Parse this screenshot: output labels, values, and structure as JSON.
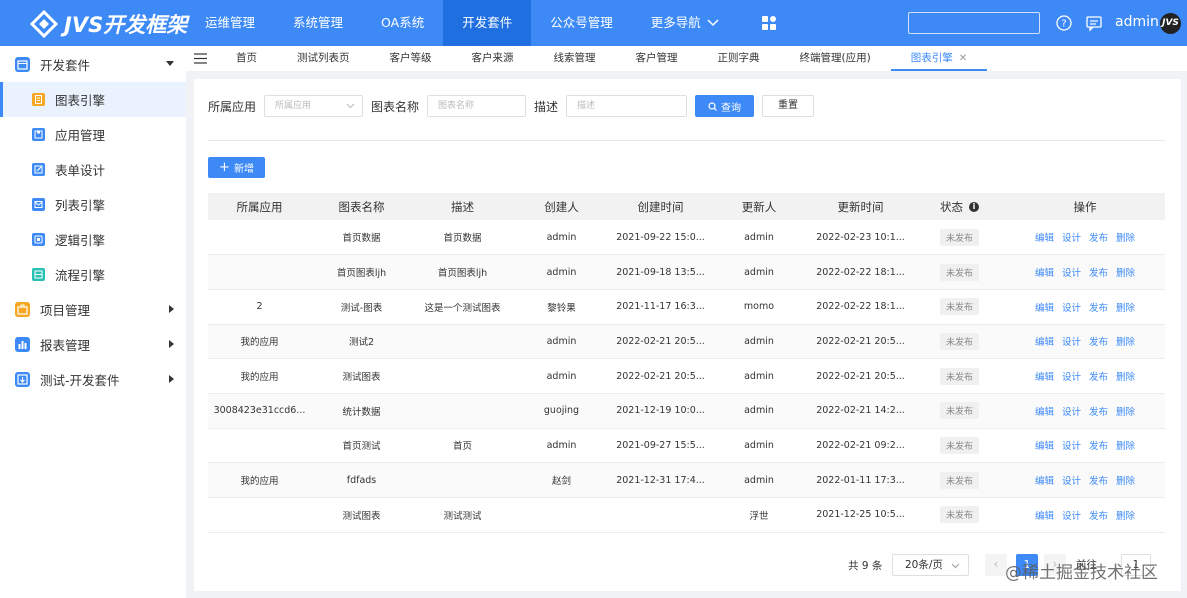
{
  "app": {
    "logo_text": "JVS开发框架",
    "top_nav": [
      {
        "label": "运维管理",
        "active": false
      },
      {
        "label": "系统管理",
        "active": false
      },
      {
        "label": "OA系统",
        "active": false
      },
      {
        "label": "开发套件",
        "active": true
      },
      {
        "label": "公众号管理",
        "active": false
      },
      {
        "label": "更多导航",
        "active": false
      }
    ],
    "admin_name": "admin",
    "avatar_text": "JVS",
    "accent_color": "#3d8af7"
  },
  "sidebar": {
    "group_dev": {
      "label": "开发套件",
      "icon": "calendar-icon",
      "expanded": true
    },
    "items": [
      {
        "label": "图表引擎",
        "icon": "document-icon",
        "active": true
      },
      {
        "label": "应用管理",
        "icon": "save-icon",
        "active": false
      },
      {
        "label": "表单设计",
        "icon": "edit-icon",
        "active": false
      },
      {
        "label": "列表引擎",
        "icon": "mail-icon",
        "active": false
      },
      {
        "label": "逻辑引擎",
        "icon": "box-icon",
        "active": false
      },
      {
        "label": "流程引擎",
        "icon": "flow-icon",
        "active": false
      }
    ],
    "groups": [
      {
        "label": "项目管理",
        "icon": "briefcase-icon"
      },
      {
        "label": "报表管理",
        "icon": "bar-chart-icon"
      },
      {
        "label": "测试-开发套件",
        "icon": "download-icon"
      }
    ]
  },
  "tabs": [
    {
      "label": "首页",
      "active": false
    },
    {
      "label": "测试列表页",
      "active": false
    },
    {
      "label": "客户等级",
      "active": false
    },
    {
      "label": "客户来源",
      "active": false
    },
    {
      "label": "线索管理",
      "active": false
    },
    {
      "label": "客户管理",
      "active": false
    },
    {
      "label": "正则字典",
      "active": false
    },
    {
      "label": "终端管理(应用)",
      "active": false
    },
    {
      "label": "图表引擎",
      "active": true
    }
  ],
  "filter": {
    "app_label": "所属应用",
    "app_placeholder": "所属应用",
    "name_label": "图表名称",
    "name_placeholder": "图表名称",
    "desc_label": "描述",
    "desc_placeholder": "描述",
    "search_button": "查询",
    "reset_button": "重置"
  },
  "add_button": "新增",
  "table": {
    "headers": [
      "所属应用",
      "图表名称",
      "描述",
      "创建人",
      "创建时间",
      "更新人",
      "更新时间",
      "状态",
      "操作"
    ],
    "rows": [
      {
        "app": "",
        "name": "首页数据",
        "desc": "首页数据",
        "creator": "admin",
        "created": "2021-09-22 15:0...",
        "updater": "admin",
        "updated": "2022-02-23 10:1...",
        "status": "未发布"
      },
      {
        "app": "",
        "name": "首页图表ljh",
        "desc": "首页图表ljh",
        "creator": "admin",
        "created": "2021-09-18 13:5...",
        "updater": "admin",
        "updated": "2022-02-22 18:1...",
        "status": "未发布"
      },
      {
        "app": "2",
        "name": "测试-图表",
        "desc": "这是一个测试图表",
        "creator": "黎铃果",
        "created": "2021-11-17 16:3...",
        "updater": "momo",
        "updated": "2022-02-22 18:1...",
        "status": "未发布"
      },
      {
        "app": "我的应用",
        "name": "测试2",
        "desc": "",
        "creator": "admin",
        "created": "2022-02-21 20:5...",
        "updater": "admin",
        "updated": "2022-02-21 20:5...",
        "status": "未发布"
      },
      {
        "app": "我的应用",
        "name": "测试图表",
        "desc": "",
        "creator": "admin",
        "created": "2022-02-21 20:5...",
        "updater": "admin",
        "updated": "2022-02-21 20:5...",
        "status": "未发布"
      },
      {
        "app": "3008423e31ccd6...",
        "name": "统计数据",
        "desc": "",
        "creator": "guojing",
        "created": "2021-12-19 10:0...",
        "updater": "admin",
        "updated": "2022-02-21 14:2...",
        "status": "未发布"
      },
      {
        "app": "",
        "name": "首页测试",
        "desc": "首页",
        "creator": "admin",
        "created": "2021-09-27 15:5...",
        "updater": "admin",
        "updated": "2022-02-21 09:2...",
        "status": "未发布"
      },
      {
        "app": "我的应用",
        "name": "fdfads",
        "desc": "",
        "creator": "赵剑",
        "created": "2021-12-31 17:4...",
        "updater": "admin",
        "updated": "2022-01-11 17:3...",
        "status": "未发布"
      },
      {
        "app": "",
        "name": "测试图表",
        "desc": "测试测试",
        "creator": "",
        "created": "",
        "updater": "浮世",
        "updated": "2021-12-25 10:5...",
        "status": "未发布"
      }
    ],
    "actions": [
      "编辑",
      "设计",
      "发布",
      "删除"
    ]
  },
  "pagination": {
    "total": "共 9 条",
    "page_size": "20条/页",
    "current_page": "1",
    "jump_label": "前往",
    "jump_value": "1"
  },
  "watermark": "@稀土掘金技术社区"
}
